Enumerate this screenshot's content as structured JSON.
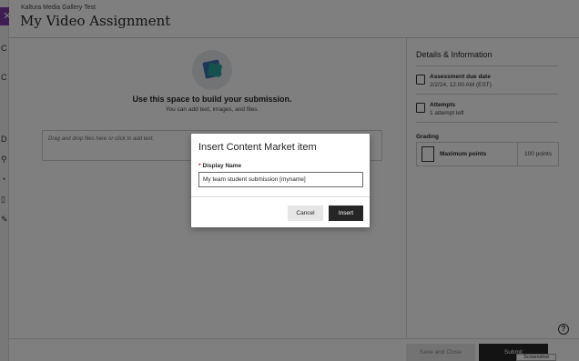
{
  "header": {
    "breadcrumb": "Kaltura Media Gallery Test",
    "title": "My Video Assignment",
    "close_glyph": "✕"
  },
  "main": {
    "hero_title": "Use this space to build your submission.",
    "hero_subtitle": "You can add text, images, and files.",
    "dropzone_placeholder": "Drag and drop files here or click to add text."
  },
  "sidebar": {
    "title": "Details & Information",
    "due_label": "Assessment due date",
    "due_value": "2/2/24, 12:00 AM (EST)",
    "attempts_label": "Attempts",
    "attempts_value": "1 attempt left",
    "grading_title": "Grading",
    "max_points_label": "Maximum points",
    "max_points_value": "100 points"
  },
  "footer": {
    "save_label": "Save and Close",
    "submit_label": "Submit",
    "screenshot_tag": "Screenshot"
  },
  "help_glyph": "?",
  "modal": {
    "title": "Insert Content Market item",
    "required_mark": "*",
    "field_label": "Display Name",
    "field_value": "My team student submission [myname]",
    "cancel_label": "Cancel",
    "insert_label": "Insert"
  },
  "colors": {
    "accent": "#7c3aa6",
    "primary_button": "#262626",
    "overlay": "rgba(0,0,0,0.5)"
  }
}
